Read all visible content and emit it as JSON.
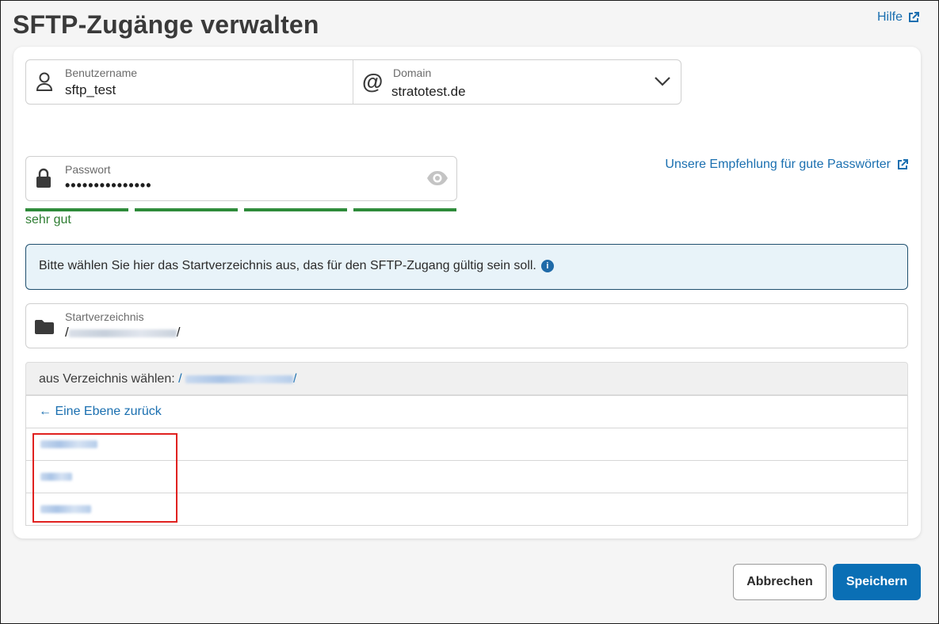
{
  "page": {
    "title": "SFTP-Zugänge verwalten",
    "help_label": "Hilfe"
  },
  "user": {
    "label": "Benutzername",
    "value": "sftp_test"
  },
  "domain": {
    "label": "Domain",
    "value": "stratotest.de"
  },
  "password": {
    "label": "Passwort",
    "value": "•••••••••••••••",
    "recommendation_link": "Unsere Empfehlung für gute Passwörter",
    "strength_label": "sehr gut",
    "strength_segments_filled": 4,
    "strength_segments_total": 4,
    "strength_color": "#2e8b3a"
  },
  "info": {
    "text": "Bitte wählen Sie hier das Startverzeichnis aus, das für den SFTP-Zugang gültig sein soll."
  },
  "start_dir": {
    "label": "Startverzeichnis",
    "prefix": "/",
    "suffix": "/"
  },
  "browser": {
    "header_label": "aus Verzeichnis wählen:",
    "path_prefix": "/",
    "path_suffix": "/",
    "back_label": "Eine Ebene zurück"
  },
  "actions": {
    "cancel": "Abbrechen",
    "save": "Speichern"
  },
  "colors": {
    "link": "#1a6fb0",
    "primary": "#0a6fb5",
    "highlight": "#e0211f",
    "info_border": "#1f4f6e"
  }
}
